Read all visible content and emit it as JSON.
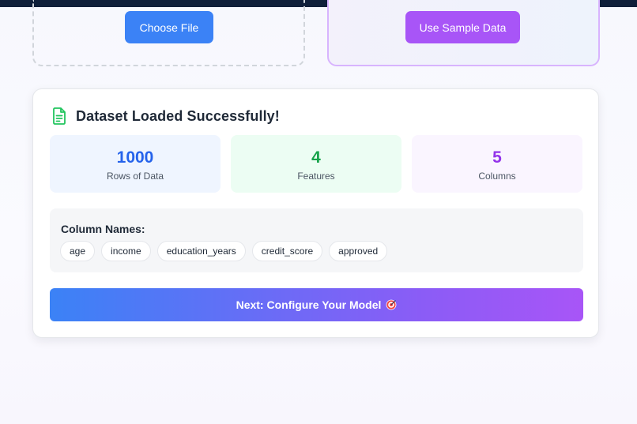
{
  "upload": {
    "choose_file_label": "Choose File",
    "sample_data_label": "Use Sample Data"
  },
  "dataset": {
    "title": "Dataset Loaded Successfully!",
    "title_icon": "document-icon",
    "stats": {
      "rows": {
        "value": "1000",
        "label": "Rows of Data"
      },
      "features": {
        "value": "4",
        "label": "Features"
      },
      "columns": {
        "value": "5",
        "label": "Columns"
      }
    },
    "column_names_heading": "Column Names:",
    "column_names": [
      "age",
      "income",
      "education_years",
      "credit_score",
      "approved"
    ],
    "next_button_label": "Next: Configure Your Model",
    "next_button_icon": "target-icon"
  },
  "colors": {
    "choose_button": "#3b82f6",
    "sample_button": "#a855f7",
    "rows_value": "#2563eb",
    "features_value": "#16a34a",
    "columns_value": "#9333ea",
    "success_icon": "#22c55e"
  }
}
